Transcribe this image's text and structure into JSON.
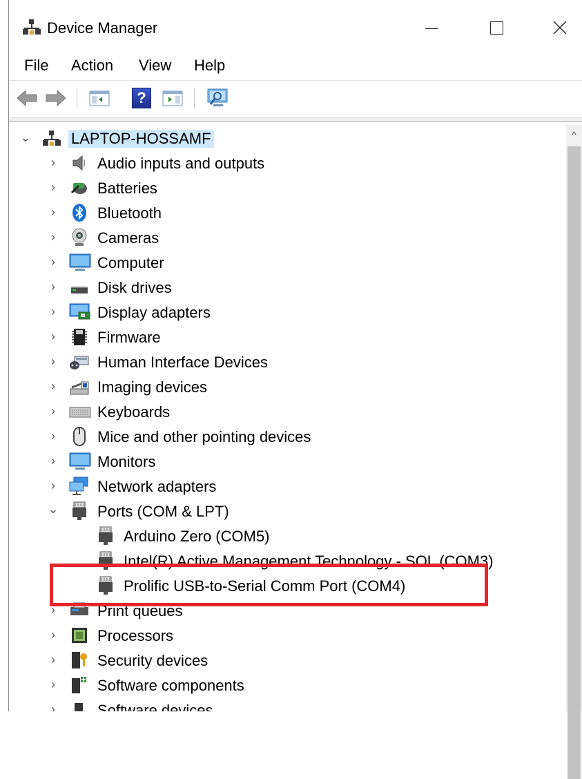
{
  "window": {
    "title": "Device Manager"
  },
  "menu": {
    "file": "File",
    "action": "Action",
    "view": "View",
    "help": "Help"
  },
  "toolbar": {
    "back_icon": "back-arrow-icon",
    "forward_icon": "forward-arrow-icon",
    "help_label": "?"
  },
  "tree": {
    "root": "LAPTOP-HOSSAMF",
    "categories": [
      {
        "label": "Audio inputs and outputs"
      },
      {
        "label": "Batteries"
      },
      {
        "label": "Bluetooth"
      },
      {
        "label": "Cameras"
      },
      {
        "label": "Computer"
      },
      {
        "label": "Disk drives"
      },
      {
        "label": "Display adapters"
      },
      {
        "label": "Firmware"
      },
      {
        "label": "Human Interface Devices"
      },
      {
        "label": "Imaging devices"
      },
      {
        "label": "Keyboards"
      },
      {
        "label": "Mice and other pointing devices"
      },
      {
        "label": "Monitors"
      },
      {
        "label": "Network adapters"
      },
      {
        "label": "Ports (COM & LPT)"
      },
      {
        "label": "Print queues"
      },
      {
        "label": "Processors"
      },
      {
        "label": "Security devices"
      },
      {
        "label": "Software components"
      },
      {
        "label": "Software devices"
      }
    ],
    "ports_children": [
      {
        "label": "Arduino Zero (COM5)"
      },
      {
        "label": "Intel(R) Active Management Technology - SOL (COM3)"
      },
      {
        "label": "Prolific USB-to-Serial Comm Port (COM4)"
      }
    ]
  },
  "colors": {
    "annotation": "#e3262c",
    "selection": "#cce8ff"
  }
}
